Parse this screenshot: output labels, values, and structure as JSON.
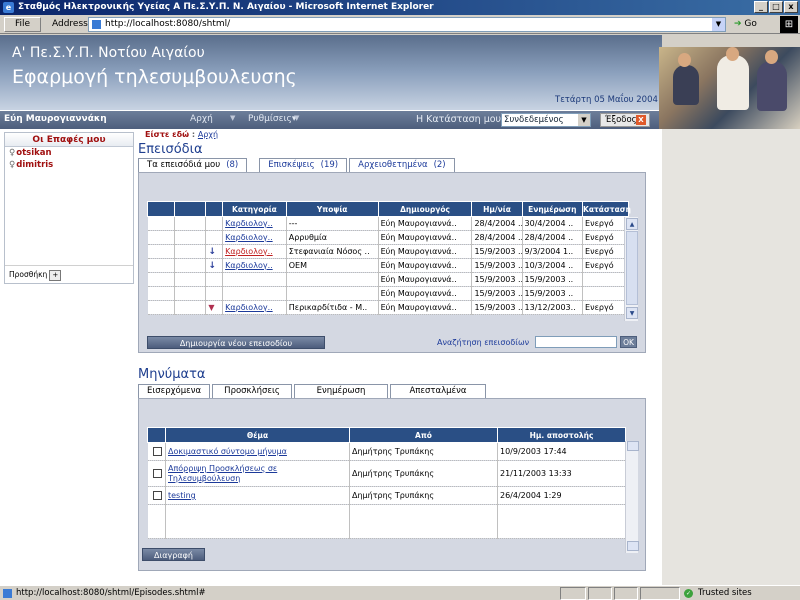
{
  "window": {
    "title": "Σταθμός Ηλεκτρονικής Υγείας Α Πε.Σ.Υ.Π. Ν. Αιγαίου - Microsoft Internet Explorer",
    "minimize": "_",
    "maximize": "□",
    "close": "x"
  },
  "toolbar": {
    "file": "File",
    "address_label": "Address",
    "url": "http://localhost:8080/shtml/",
    "go": "Go"
  },
  "banner": {
    "org": "Α' Πε.Σ.Υ.Π. Νοτίου Αιγαίου",
    "app": "Εφαρμογή τηλεσυμβουλευσης",
    "date": "Τετάρτη 05 Μαΐου 2004"
  },
  "navbar": {
    "user": "Εύη Μαυρογιαννάκη",
    "home": "Αρχή",
    "settings": "Ρυθμίσεις",
    "status_label": "Η Κατάσταση μου",
    "status_value": "Συνδεδεμένος",
    "exit": "Έξοδος"
  },
  "contacts": {
    "title": "Οι Επαφές μου",
    "items": [
      "otsikan",
      "dimitris"
    ],
    "add": "Προσθήκη"
  },
  "breadcrumb": {
    "label": "Είστε εδώ",
    "home": "Αρχή"
  },
  "episodes": {
    "title": "Επεισόδια",
    "tabs": [
      {
        "label": "Τα επεισόδιά μου",
        "count": "(8)"
      },
      {
        "label": "Επισκέψεις",
        "count": "(19)"
      },
      {
        "label": "Αρχειοθετημένα",
        "count": "(2)"
      }
    ],
    "columns": [
      "Κατηγορία",
      "Υποψία",
      "Δημιουργός",
      "Ημ/νία",
      "Ενημέρωση",
      "Κατάσταση"
    ],
    "rows": [
      {
        "icon": "",
        "category": "Καρδιολογ..",
        "suspicion": "---",
        "creator": "Εύη Μαυρογιαννά..",
        "date": "28/4/2004 ..",
        "update": "30/4/2004 ..",
        "status": "Ενεργό"
      },
      {
        "icon": "",
        "category": "Καρδιολογ..",
        "suspicion": "Αρρυθμία",
        "creator": "Εύη Μαυρογιαννά..",
        "date": "28/4/2004 ..",
        "update": "28/4/2004 ..",
        "status": "Ενεργό"
      },
      {
        "icon": "arrow",
        "category": "Καρδιολογ..",
        "suspicion": "Στεφανιαία Νόσος ..",
        "creator": "Εύη Μαυρογιαννά..",
        "date": "15/9/2003 ..",
        "update": "9/3/2004 1..",
        "status": "Ενεργό"
      },
      {
        "icon": "arrow",
        "category": "Καρδιολογ..",
        "suspicion": "OEM",
        "creator": "Εύη Μαυρογιαννά..",
        "date": "15/9/2003 ..",
        "update": "10/3/2004 ..",
        "status": "Ενεργό"
      },
      {
        "icon": "",
        "category": "",
        "suspicion": "",
        "creator": "Εύη Μαυρογιαννά..",
        "date": "15/9/2003 ..",
        "update": "15/9/2003 ..",
        "status": ""
      },
      {
        "icon": "",
        "category": "",
        "suspicion": "",
        "creator": "Εύη Μαυρογιαννά..",
        "date": "15/9/2003 ..",
        "update": "15/9/2003 ..",
        "status": ""
      },
      {
        "icon": "flag",
        "category": "Καρδιολογ..",
        "suspicion": "Περικαρδίτιδα - Μ..",
        "creator": "Εύη Μαυρογιαννά..",
        "date": "15/9/2003 ..",
        "update": "13/12/2003..",
        "status": "Ενεργό"
      }
    ],
    "new_button": "Δημιουργία νέου επεισοδίου",
    "search_label": "Αναζήτηση επεισοδίων",
    "search_value": "",
    "ok": "OK"
  },
  "messages": {
    "title": "Μηνύματα",
    "tabs": [
      "Εισερχόμενα",
      "Προσκλήσεις",
      "Ενημέρωση",
      "Απεσταλμένα"
    ],
    "columns": [
      "Θέμα",
      "Από",
      "Ημ. αποστολής"
    ],
    "rows": [
      {
        "subject": "Δοκιμαστικό σύντομο μήνυμα",
        "subject2": "",
        "from": "Δημήτρης Τρυπάκης",
        "sent": "10/9/2003 17:44"
      },
      {
        "subject": "Απόρριψη Προσκλήσεως σε",
        "subject2": "Τηλεσυμβούλευση",
        "from": "Δημήτρης Τρυπάκης",
        "sent": "21/11/2003 13:33"
      },
      {
        "subject": "testing",
        "subject2": "",
        "from": "Δημήτρης Τρυπάκης",
        "sent": "26/4/2004 1:29"
      }
    ],
    "delete_button": "Διαγραφή"
  },
  "statusbar": {
    "url": "http://localhost:8080/shtml/Episodes.shtml#",
    "zone": "Trusted sites"
  }
}
